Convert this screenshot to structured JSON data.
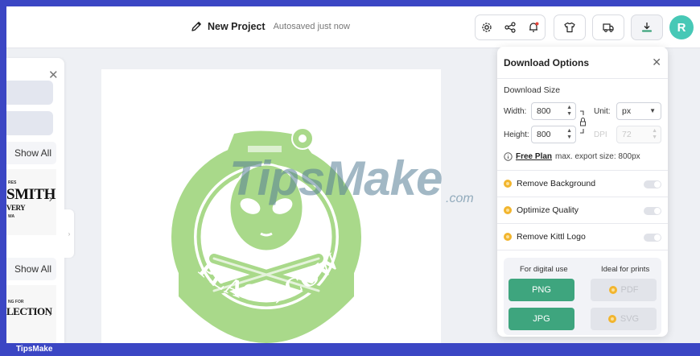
{
  "header": {
    "project_name": "New Project",
    "autosave_status": "Autosaved just now",
    "avatar_initial": "R",
    "icons": [
      "settings-icon",
      "share-icon",
      "notification-icon",
      "tshirt-icon",
      "delivery-truck-icon",
      "download-icon"
    ]
  },
  "sidebar": {
    "show_all_1": "Show All",
    "show_all_2": "Show All",
    "thumb1_text": "SMITH",
    "thumb1_subtext": "VERY",
    "thumb2_text": "LECTION"
  },
  "canvas": {
    "artwork_text": "PEACE, COWBOY!",
    "watermark_main": "TipsMake",
    "watermark_suffix": ".com"
  },
  "download_panel": {
    "title": "Download Options",
    "size_heading": "Download Size",
    "width_label": "Width:",
    "width_value": "800",
    "height_label": "Height:",
    "height_value": "800",
    "unit_label": "Unit:",
    "unit_value": "px",
    "dpi_label": "DPI",
    "dpi_value": "72",
    "plan_link": "Free Plan",
    "plan_note": "max. export size: 800px",
    "options": [
      {
        "label": "Remove Background",
        "enabled": false
      },
      {
        "label": "Optimize Quality",
        "enabled": false
      },
      {
        "label": "Remove Kittl Logo",
        "enabled": false
      }
    ],
    "digital_heading": "For digital use",
    "print_heading": "Ideal for prints",
    "formats": {
      "png": "PNG",
      "jpg": "JPG",
      "pdf": "PDF",
      "svg": "SVG"
    }
  },
  "footer": {
    "brand": "TipsMake"
  },
  "colors": {
    "accent_green": "#3ea57e",
    "avatar": "#47c8b6",
    "artwork_green": "#a9d98a",
    "bar_blue": "#3b46c4",
    "premium_coin": "#f2b52e"
  }
}
